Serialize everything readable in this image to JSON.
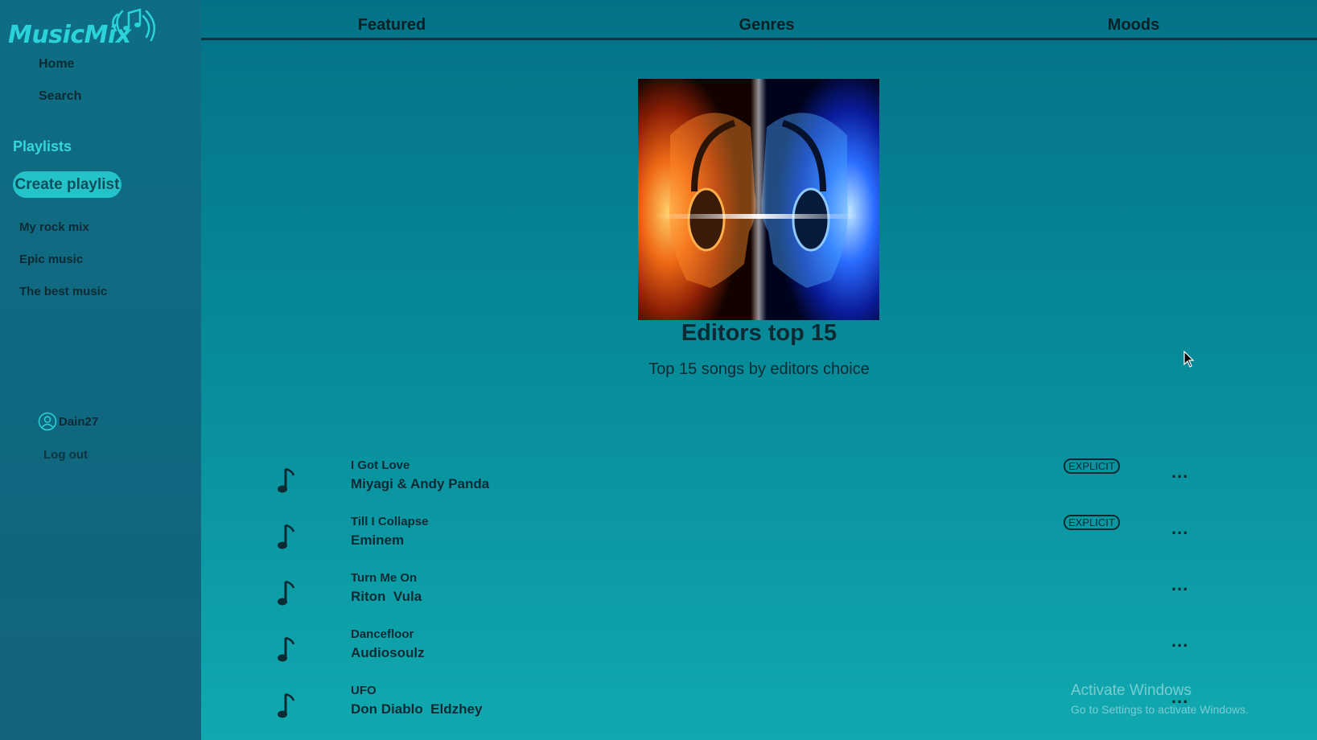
{
  "app": {
    "name": "MusicMix",
    "accent": "#2ad3d9"
  },
  "sidebar": {
    "nav": [
      {
        "label": "Home"
      },
      {
        "label": "Search"
      }
    ],
    "playlists_heading": "Playlists",
    "create_playlist_label": "Create playlist",
    "playlists": [
      {
        "label": "My rock mix"
      },
      {
        "label": "Epic music"
      },
      {
        "label": "The best music"
      }
    ],
    "user": {
      "name": "Dain27",
      "icon": "user-circle-icon"
    },
    "logout_label": "Log out"
  },
  "tabs": [
    {
      "label": "Featured"
    },
    {
      "label": "Genres"
    },
    {
      "label": "Moods"
    }
  ],
  "playlist": {
    "title": "Editors top 15",
    "description": "Top 15 songs by editors choice",
    "cover_image": "two-faces-with-headphones-fire-and-ice"
  },
  "songs": [
    {
      "title": "I Got Love",
      "artist": "Miyagi & Andy Panda",
      "explicit": true,
      "explicit_label": "EXPLICIT",
      "more_label": "..."
    },
    {
      "title": "Till I Collapse",
      "artist": "Eminem",
      "explicit": true,
      "explicit_label": "EXPLICIT",
      "more_label": "..."
    },
    {
      "title": "Turn Me On",
      "artist": "Riton  Vula",
      "explicit": false,
      "more_label": "..."
    },
    {
      "title": "Dancefloor",
      "artist": "Audiosoulz",
      "explicit": false,
      "more_label": "..."
    },
    {
      "title": "UFO",
      "artist": "Don Diablo  Eldzhey",
      "explicit": false,
      "more_label": "..."
    }
  ],
  "watermark": {
    "title": "Activate Windows",
    "subtitle": "Go to Settings to activate Windows."
  }
}
